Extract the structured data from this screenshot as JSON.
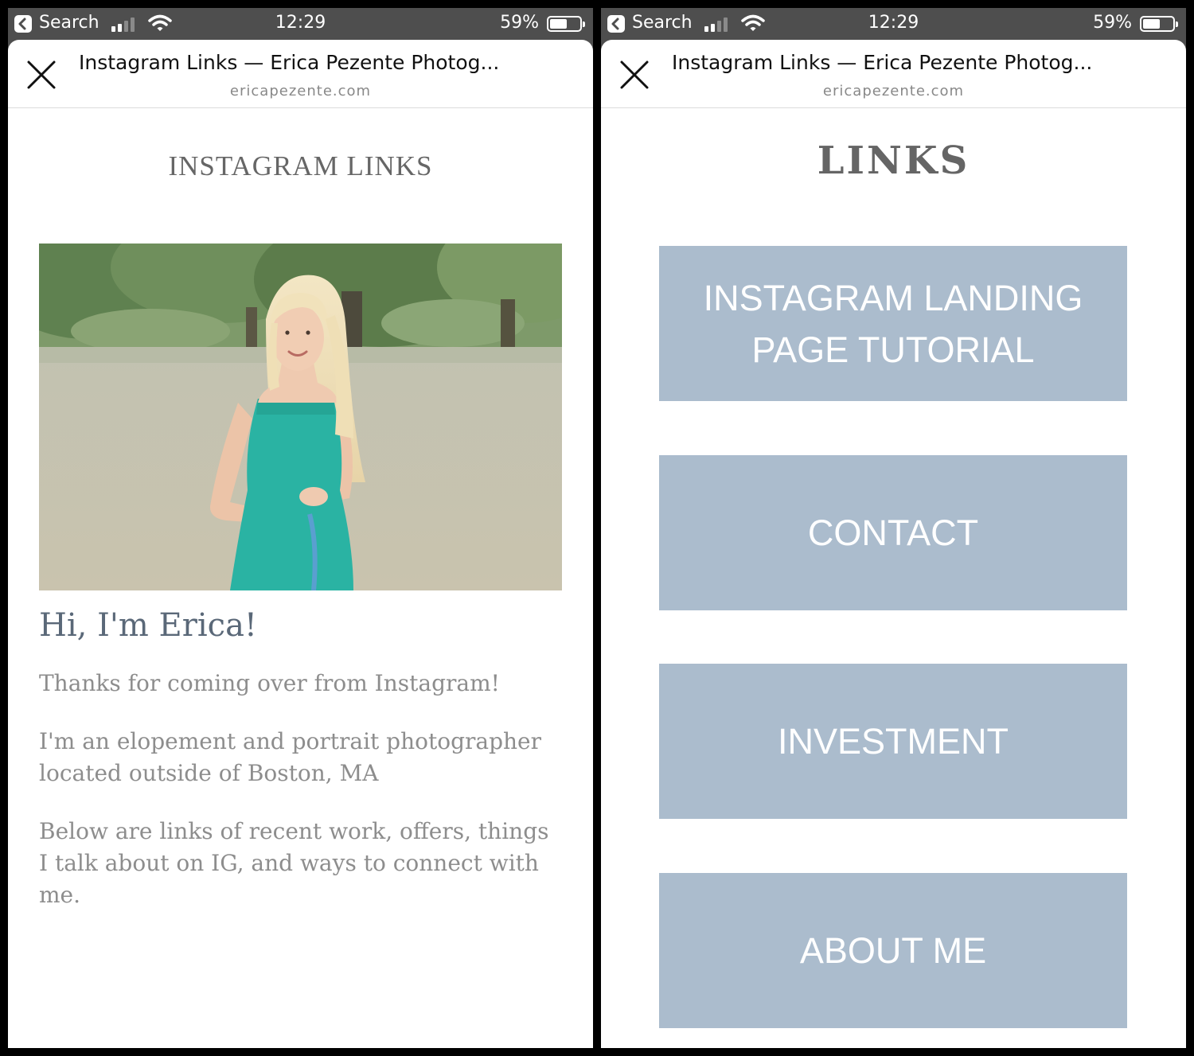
{
  "status_bar": {
    "back_label": "Search",
    "time": "12:29",
    "battery_percent": "59%",
    "battery_level": 0.59,
    "signal_bars_active": 2,
    "signal_bars_total": 4
  },
  "browser": {
    "page_title": "Instagram Links — Erica Pezente Photog...",
    "domain": "ericapezente.com"
  },
  "left_page": {
    "heading": "INSTAGRAM LINKS",
    "photo_description_icon": "portrait-photo",
    "greeting": "Hi, I'm Erica!",
    "paragraphs": [
      "Thanks for coming over from Instagram!",
      "I'm an elopement and portrait photographer located outside of Boston, MA",
      "Below are links of recent work, offers, things I talk about on IG, and ways to connect with me."
    ]
  },
  "right_page": {
    "heading": "LINKS",
    "buttons": [
      "INSTAGRAM LANDING PAGE TUTORIAL",
      "CONTACT",
      "INVESTMENT",
      "ABOUT ME"
    ]
  },
  "colors": {
    "button_bg": "#abbccd",
    "greeting": "#5a6878",
    "body_text": "#8d8d8d",
    "status_bar_bg": "#4e4e4e"
  }
}
